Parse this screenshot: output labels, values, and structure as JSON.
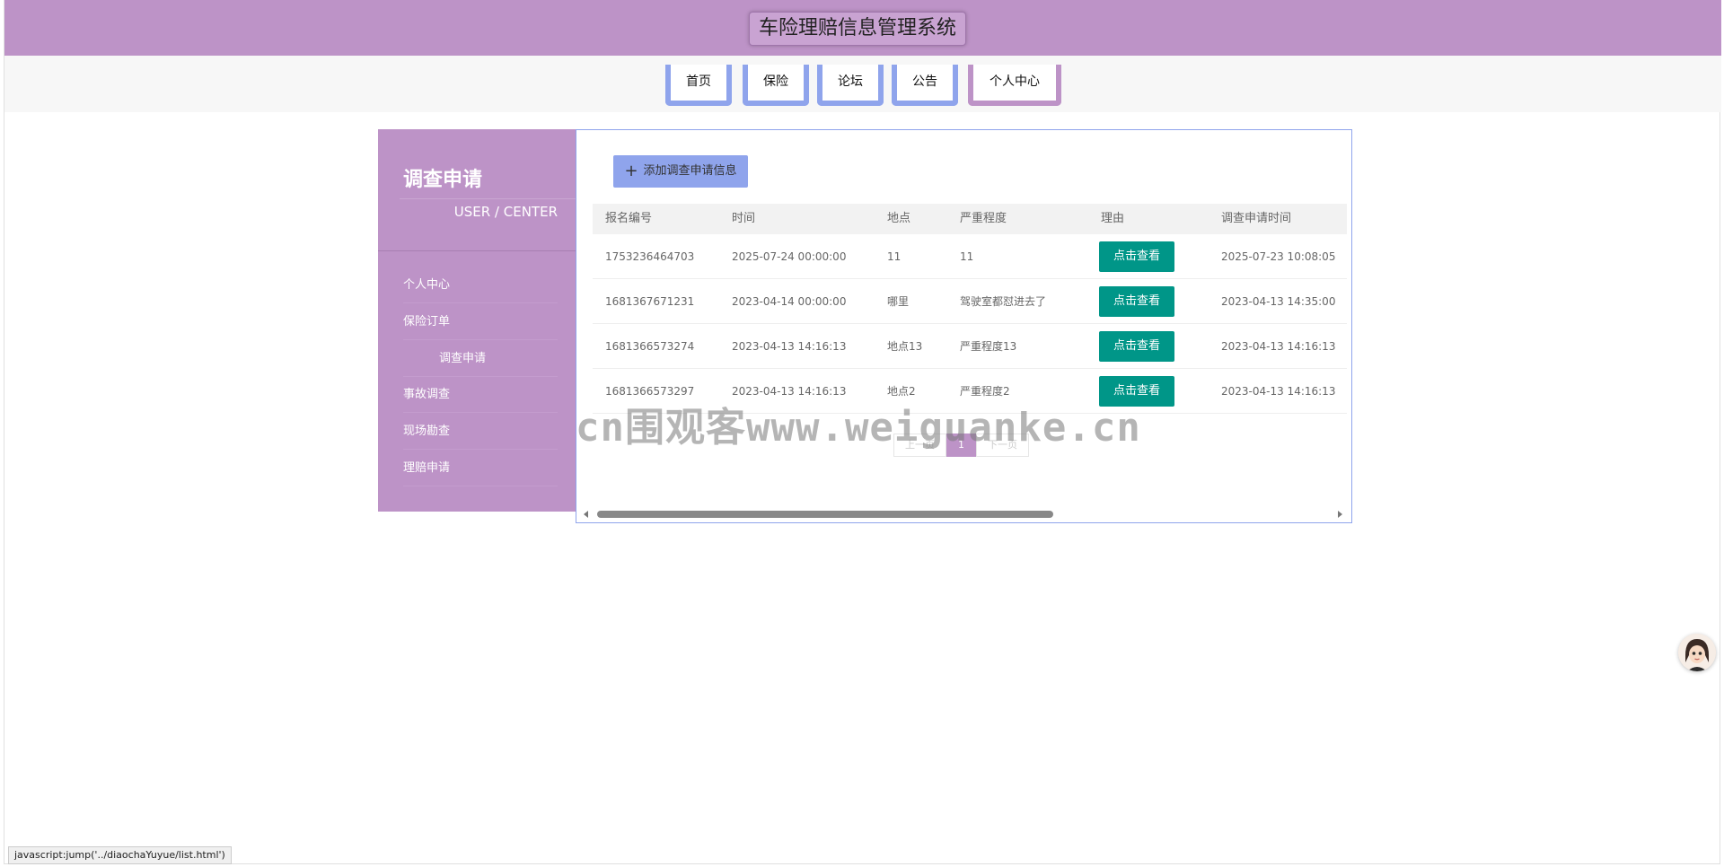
{
  "header": {
    "title": "车险理赔信息管理系统"
  },
  "nav": {
    "items": [
      {
        "label": "首页"
      },
      {
        "label": "保险"
      },
      {
        "label": "论坛"
      },
      {
        "label": "公告"
      },
      {
        "label": "个人中心"
      }
    ]
  },
  "sidebar": {
    "title": "调查申请",
    "subtitle": "USER / CENTER",
    "items": [
      {
        "label": "个人中心"
      },
      {
        "label": "保险订单"
      },
      {
        "label": "调查申请"
      },
      {
        "label": "事故调查"
      },
      {
        "label": "现场勘查"
      },
      {
        "label": "理赔申请"
      }
    ]
  },
  "content": {
    "add_button": "添加调查申请信息",
    "columns": [
      "报名编号",
      "时间",
      "地点",
      "严重程度",
      "理由",
      "调查申请时间"
    ],
    "view_label": "点击查看",
    "rows": [
      {
        "id": "1753236464703",
        "time": "2025-07-24 00:00:00",
        "place": "11",
        "severity": "11",
        "apply_time": "2025-07-23 10:08:05"
      },
      {
        "id": "1681367671231",
        "time": "2023-04-14 00:00:00",
        "place": "哪里",
        "severity": "驾驶室都怼进去了",
        "apply_time": "2023-04-13 14:35:00"
      },
      {
        "id": "1681366573274",
        "time": "2023-04-13 14:16:13",
        "place": "地点13",
        "severity": "严重程度13",
        "apply_time": "2023-04-13 14:16:13"
      },
      {
        "id": "1681366573297",
        "time": "2023-04-13 14:16:13",
        "place": "地点2",
        "severity": "严重程度2",
        "apply_time": "2023-04-13 14:16:13"
      }
    ],
    "pager": {
      "prev": "上一页",
      "current": "1",
      "next": "下一页"
    }
  },
  "watermark": "cn围观客www.weiguanke.cn",
  "statusbar": {
    "text": "javascript:jump('../diaochaYuyue/list.html')"
  },
  "colors": {
    "header": "#bd93c7",
    "nav_border": "#8fa4ec",
    "view_button": "#009688"
  }
}
